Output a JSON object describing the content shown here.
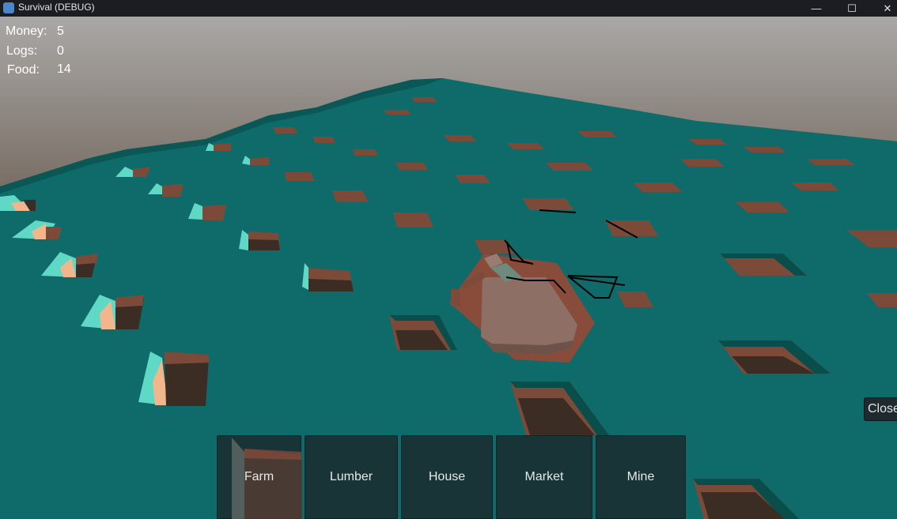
{
  "window": {
    "title": "Survival (DEBUG)",
    "minimize_glyph": "—",
    "maximize_glyph": "☐",
    "close_glyph": "✕"
  },
  "hud": {
    "money": {
      "label": "Money:",
      "value": "5"
    },
    "logs": {
      "label": "Logs:",
      "value": "0"
    },
    "food": {
      "label": "Food:",
      "value": "14"
    }
  },
  "build_menu": {
    "buttons": [
      {
        "label": "Farm"
      },
      {
        "label": "Lumber"
      },
      {
        "label": "House"
      },
      {
        "label": "Market"
      },
      {
        "label": "Mine"
      }
    ]
  },
  "close_button": {
    "label": "Close"
  },
  "colors": {
    "ground": "#0f6a69",
    "sky_top": "#9a9896",
    "sky_bottom": "#3f2f22",
    "dirt": "#8a4f3c",
    "dirt_dark": "#3b2d24",
    "tree_cyan": "#5ed6c4",
    "tree_peach": "#f0b48a",
    "building": "#8e7165",
    "ui_panel": "#1b2c30"
  }
}
